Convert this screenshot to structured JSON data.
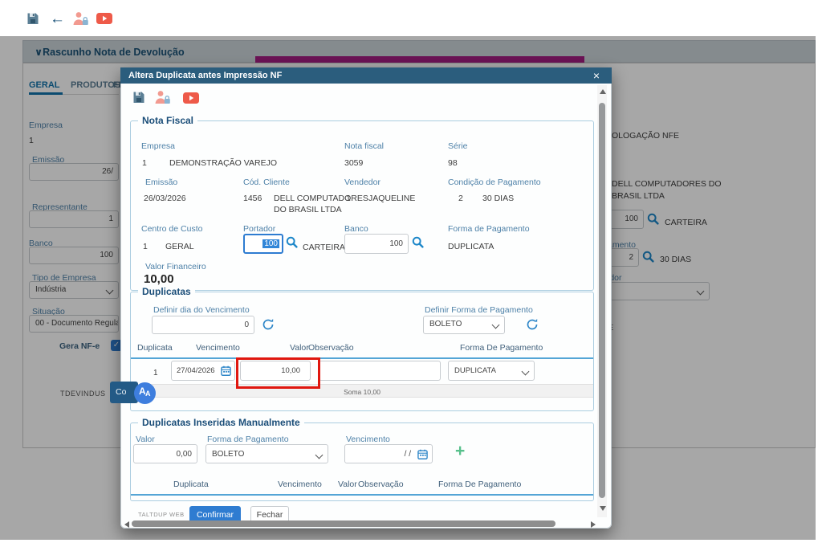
{
  "topbar": {
    "back_glyph": "←"
  },
  "background": {
    "panel_chevron": "∨",
    "panel_title": "Rascunho Nota de Devolução",
    "tabs": {
      "geral": "GERAL",
      "produtos": "PRODUTOS",
      "frete_fragment": "FRE"
    },
    "left": {
      "empresa_label": "Empresa",
      "empresa_value": "1",
      "emissao_label": "Emissão",
      "emissao_value": "26/",
      "representante_label": "Representante",
      "representante_value": "1",
      "banco_label": "Banco",
      "banco_value": "100",
      "tipo_empresa_label": "Tipo de Empresa",
      "tipo_empresa_value": "Indústria",
      "situacao_label": "Situação",
      "situacao_value": "00 - Documento Regula",
      "gera_nfe_label": "Gera NF-e",
      "check_glyph": "✓"
    },
    "right": {
      "homologacao_fragment": "OLOGAÇÃO NFE",
      "cliente_line1": "DELL COMPUTADORES DO",
      "cliente_line2": "BRASIL LTDA",
      "portador_value": "100",
      "portador_desc": "CARTEIRA",
      "condicao_label_fragment": "amento",
      "condicao_value": "2",
      "condicao_desc": "30 DIAS",
      "consumidor_label_fragment": "idor",
      "nfe_fragment": "E"
    },
    "footer": {
      "brand": "TDEVINDUS",
      "confirm_fragment": "Co"
    }
  },
  "modal": {
    "title": "Altera Duplicata antes Impressão NF",
    "close_glyph": "×",
    "nota_fiscal": {
      "legend": "Nota Fiscal",
      "empresa_label": "Empresa",
      "empresa_code": "1",
      "empresa_name": "DEMONSTRAÇÃO VAREJO",
      "nota_label": "Nota fiscal",
      "nota_value": "3059",
      "serie_label": "Série",
      "serie_value": "98",
      "emissao_label": "Emissão",
      "emissao_value": "26/03/2026",
      "cliente_label": "Cód. Cliente",
      "cliente_code": "1456",
      "cliente_name_line1": "DELL COMPUTADORES",
      "cliente_name_line2": "DO BRASIL LTDA",
      "vendedor_label": "Vendedor",
      "vendedor_code": "1",
      "vendedor_name": "JAQUELINE",
      "condicao_label": "Condição de Pagamento",
      "condicao_code": "2",
      "condicao_name": "30 DIAS",
      "centro_label": "Centro de Custo",
      "centro_code": "1",
      "centro_name": "GERAL",
      "portador_label": "Portador",
      "portador_value": "100",
      "portador_desc": "CARTEIRA",
      "banco_label": "Banco",
      "banco_value": "100",
      "forma_label": "Forma de Pagamento",
      "forma_value": "DUPLICATA",
      "valor_financeiro_label": "Valor Financeiro",
      "valor_financeiro_value": "10,00"
    },
    "duplicatas": {
      "legend": "Duplicatas",
      "definir_dia_label": "Definir dia do Vencimento",
      "definir_dia_value": "0",
      "definir_forma_label": "Definir Forma de Pagamento",
      "definir_forma_value": "BOLETO",
      "headers": [
        "Duplicata",
        "Vencimento",
        "Valor",
        "Observação",
        "Forma De Pagamento"
      ],
      "row": {
        "duplicata": "1",
        "vencimento": "27/04/2026",
        "valor": "10,00",
        "observacao": "",
        "forma": "DUPLICATA"
      },
      "soma": "Soma 10,00"
    },
    "manuais": {
      "legend": "Duplicatas Inseridas Manualmente",
      "valor_label": "Valor",
      "valor_value": "0,00",
      "forma_label": "Forma de Pagamento",
      "forma_value": "BOLETO",
      "vencimento_label": "Vencimento",
      "vencimento_value": "/ /",
      "plus_glyph": "+",
      "headers": [
        "Duplicata",
        "Vencimento",
        "Valor",
        "Observação",
        "Forma De Pagamento"
      ]
    },
    "footer": {
      "program": "TALTDUP WEB",
      "confirm": "Confirmar",
      "close": "Fechar"
    }
  },
  "floating": {
    "translate_a1": "A",
    "translate_a2": "A"
  },
  "colors": {
    "modal_header": "#2b5d7d",
    "primary_button": "#2e7cd1",
    "annotation_red": "#e0170f",
    "purple_bar": "#6b1355",
    "youtube_red": "#ee5a49",
    "person_salmon": "#f29a90",
    "label_blue": "#4e81a8",
    "legend_blue": "#1b4e79",
    "active_tab_blue": "#1273ab"
  }
}
